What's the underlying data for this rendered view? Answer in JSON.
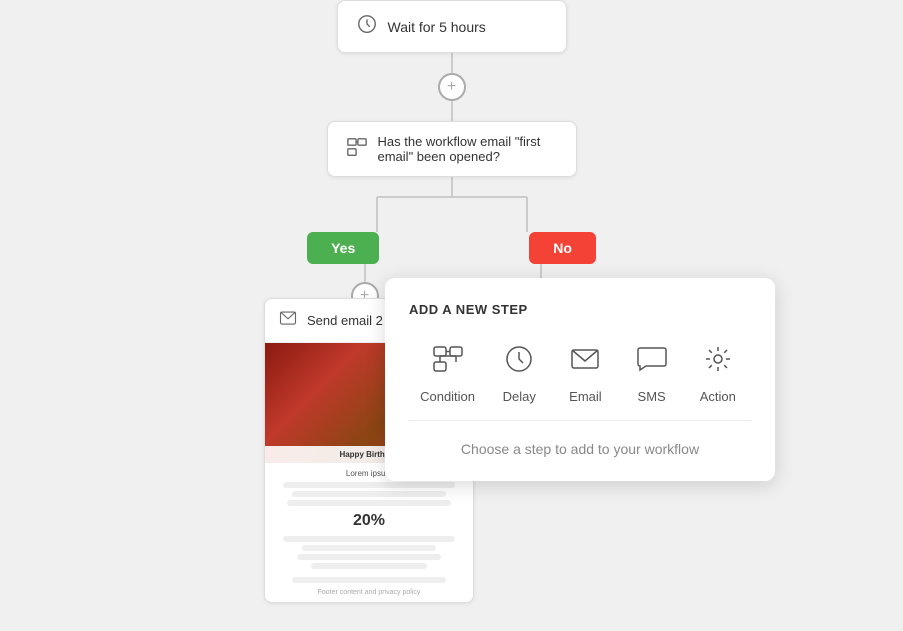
{
  "workflow": {
    "wait_node": {
      "label": "Wait for 5 hours"
    },
    "condition_node": {
      "label": "Has the workflow email \"first email\" been opened?"
    },
    "yes_button": "Yes",
    "no_button": "No",
    "send_email_node": {
      "label": "Send email 2"
    }
  },
  "modal": {
    "title": "ADD A NEW STEP",
    "items": [
      {
        "id": "condition",
        "label": "Condition"
      },
      {
        "id": "delay",
        "label": "Delay"
      },
      {
        "id": "email",
        "label": "Email"
      },
      {
        "id": "sms",
        "label": "SMS"
      },
      {
        "id": "action",
        "label": "Action"
      }
    ],
    "hint": "Choose a step to add to your workflow"
  },
  "email_preview": {
    "header_label": "Send email 2",
    "birthday_text": "Happy Birthday",
    "lorem_text": "Lorem ipsum",
    "percentage": "20%",
    "footer_text": "Footer content and privacy policy"
  }
}
